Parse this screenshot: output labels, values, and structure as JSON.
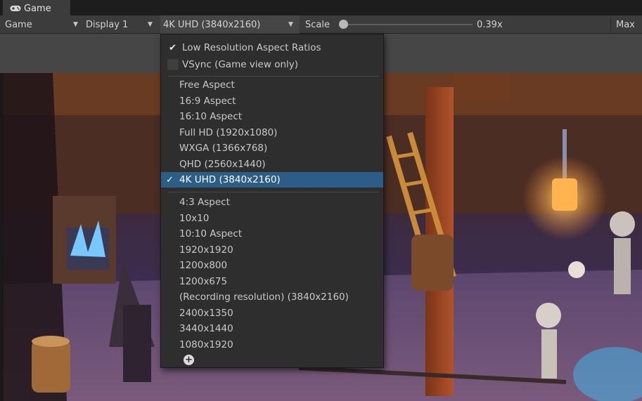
{
  "tab": {
    "label": "Game",
    "icon": "gamepad-icon"
  },
  "toolbar": {
    "view_select": "Game",
    "display_select": "Display 1",
    "resolution_select": "4K UHD (3840x2160)",
    "scale_label": "Scale",
    "scale_value": "0.39x",
    "max_label": "Max"
  },
  "menu": {
    "toggles": [
      {
        "label": "Low Resolution Aspect Ratios",
        "checked": true
      },
      {
        "label": "VSync (Game view only)",
        "checked": false
      }
    ],
    "builtin": [
      "Free Aspect",
      "16:9 Aspect",
      "16:10 Aspect",
      "Full HD (1920x1080)",
      "WXGA (1366x768)",
      "QHD (2560x1440)",
      "4K UHD (3840x2160)"
    ],
    "selected": "4K UHD (3840x2160)",
    "custom": [
      "4:3 Aspect",
      "10x10",
      "10:10 Aspect",
      "1920x1920",
      "1200x800",
      "1200x675",
      "(Recording resolution) (3840x2160)",
      "2400x1350",
      "3440x1440",
      "1080x1920"
    ],
    "add_icon": "plus-circle-icon"
  },
  "colors": {
    "selection": "#2c5d87",
    "menu_bg": "#2e2e2e",
    "toolbar_bg": "#3c3c3c"
  }
}
